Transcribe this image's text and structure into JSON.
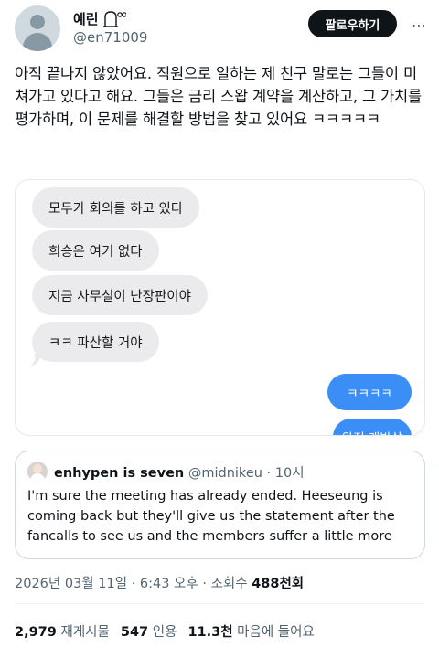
{
  "header": {
    "display_name": "예린",
    "name_icon": "ghost-eyes-icon",
    "handle": "@en71009",
    "follow_label": "팔로우하기",
    "more_icon": "more-dots-icon"
  },
  "tweet": {
    "text": "아직 끝나지 않았어요. 직원으로 일하는 제 친구 말로는 그들이 미쳐가고 있다고 해요. 그들은 금리 스왑 계약을 계산하고, 그 가치를 평가하며, 이 문제를 해결할 방법을 찾고 있어요 ㅋㅋㅋㅋㅋ"
  },
  "chat": {
    "incoming": [
      "모두가 회의를 하고 있다",
      "희승은 여기 없다",
      "지금 사무실이 난장판이야",
      "ㅋㅋ 파산할 거야"
    ],
    "outgoing": [
      "ㅋㅋㅋㅋ",
      "완전 개박살"
    ],
    "colors": {
      "incoming_bg": "#ebebee",
      "outgoing_bg": "#3a8ef6"
    }
  },
  "quote": {
    "name": "enhypen is seven",
    "handle": "@midnikeu",
    "separator": "·",
    "time": "10시",
    "text": "I'm sure the meeting has already ended. Heeseung is coming back but they'll give us the statement after the fancalls to see us and the members suffer a little more"
  },
  "meta": {
    "date": "2026년 03월 11일",
    "sep1": "·",
    "time": "6:43 오후",
    "sep2": "·",
    "views_label": "조회수",
    "views_value": "488천회"
  },
  "stats": [
    {
      "num": "2,979",
      "label": "재게시물"
    },
    {
      "num": "547",
      "label": "인용"
    },
    {
      "num": "11.3천",
      "label": "마음에 들어요"
    }
  ]
}
